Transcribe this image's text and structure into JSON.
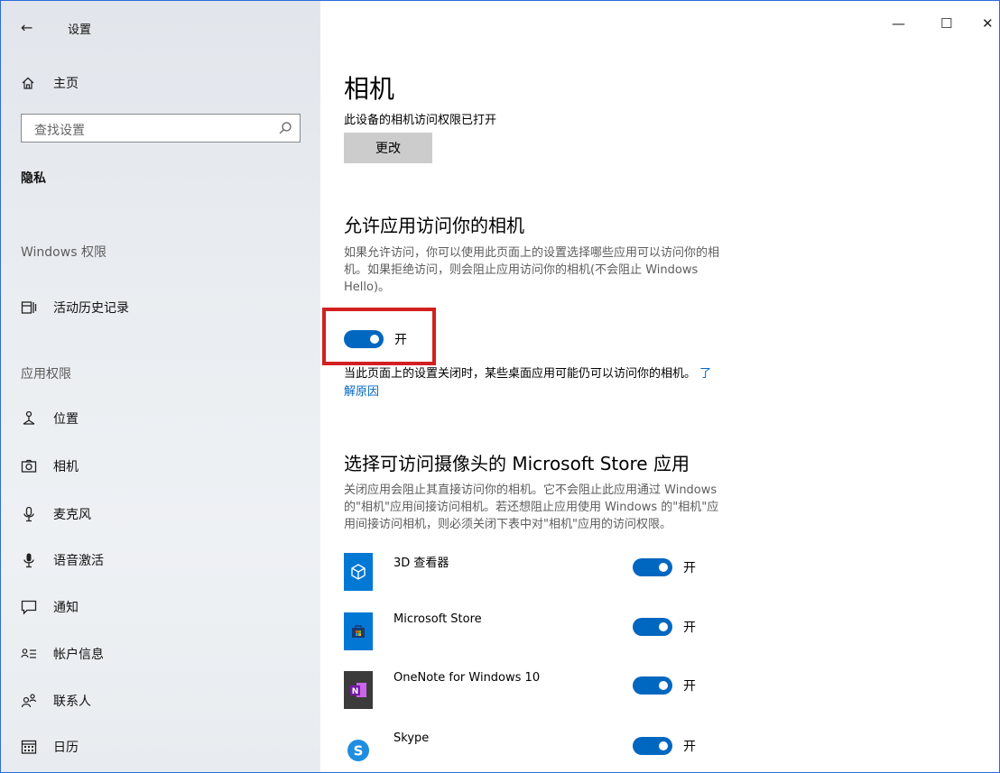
{
  "window": {
    "title": "设置",
    "back_glyph": "←",
    "minimize_glyph": "—",
    "maximize_glyph": "☐",
    "close_glyph": "✕"
  },
  "sidebar": {
    "home_label": "主页",
    "search_placeholder": "查找设置",
    "current_section": "隐私",
    "groups": {
      "windows_permissions": "Windows 权限",
      "app_permissions": "应用权限"
    },
    "items": [
      {
        "label": "活动历史记录",
        "icon": "activity-history-icon"
      },
      {
        "label": "位置",
        "icon": "location-icon"
      },
      {
        "label": "相机",
        "icon": "camera-icon"
      },
      {
        "label": "麦克风",
        "icon": "microphone-icon"
      },
      {
        "label": "语音激活",
        "icon": "voice-activation-icon"
      },
      {
        "label": "通知",
        "icon": "notification-icon"
      },
      {
        "label": "帐户信息",
        "icon": "account-info-icon"
      },
      {
        "label": "联系人",
        "icon": "contacts-icon"
      },
      {
        "label": "日历",
        "icon": "calendar-icon"
      }
    ]
  },
  "main": {
    "title": "相机",
    "device_status": "此设备的相机访问权限已打开",
    "change_button": "更改",
    "allow_heading": "允许应用访问你的相机",
    "allow_desc_line1": "如果允许访问，你可以使用此页面上的设置选择哪些应用可以访问你的相",
    "allow_desc_line2": "机。如果拒绝访问，则会阻止应用访问你的相机(不会阻止 Windows",
    "allow_desc_line3": "Hello)。",
    "master_toggle": {
      "state": "on",
      "label": "开"
    },
    "note_text": "当此页面上的设置关闭时，某些桌面应用可能仍可以访问你的相机。",
    "note_link_part1": "了",
    "note_link_part2": "解原因",
    "store_heading": "选择可访问摄像头的 Microsoft Store 应用",
    "store_desc_line1": "关闭应用会阻止其直接访问你的相机。它不会阻止此应用通过 Windows",
    "store_desc_line2": "的\"相机\"应用间接访问相机。若还想阻止应用使用 Windows 的\"相机\"应",
    "store_desc_line3": "用间接访问相机，则必须关闭下表中对\"相机\"应用的访问权限。",
    "apps": [
      {
        "name": "3D 查看器",
        "icon": "3d-viewer-icon",
        "toggle": "on",
        "toggle_label": "开"
      },
      {
        "name": "Microsoft Store",
        "icon": "microsoft-store-icon",
        "toggle": "on",
        "toggle_label": "开"
      },
      {
        "name": "OneNote for Windows 10",
        "icon": "onenote-icon",
        "toggle": "on",
        "toggle_label": "开"
      },
      {
        "name": "Skype",
        "icon": "skype-icon",
        "toggle": "on",
        "toggle_label": "开"
      }
    ]
  },
  "colors": {
    "accent": "#0067c0",
    "highlight_border": "#d31f1f",
    "button_bg": "#cccccc"
  }
}
